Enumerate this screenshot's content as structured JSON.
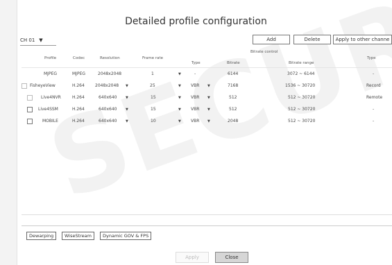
{
  "title": "Detailed profile configuration",
  "channel": {
    "value": "CH 01",
    "caret": "▼"
  },
  "buttons": {
    "add": "Add",
    "delete": "Delete",
    "apply_other": "Apply to other channe"
  },
  "headers": {
    "profile": "Profile",
    "codec": "Codec",
    "resolution": "Resolution",
    "frame_rate": "Frame rate",
    "bitrate_control": "Bitrate control",
    "type": "Type",
    "bitrate": "Bitrate",
    "bitrate_range": "Bitrate range",
    "type2": "Type"
  },
  "rows": [
    {
      "profile": "MJPEG",
      "codec": "MJPEG",
      "resolution": "2048x2048",
      "res_caret": "▼",
      "frame_rate": "1",
      "fr_caret": "▼",
      "type": "-",
      "type_caret": "",
      "bitrate": "6144",
      "range": "3072 ~ 6144",
      "use": "-",
      "has_check": false
    },
    {
      "profile": "FisheyeView",
      "codec": "H.264",
      "resolution": "2048x2048",
      "res_caret": "▼",
      "frame_rate": "25",
      "fr_caret": "▼",
      "type": "VBR",
      "type_caret": "▼",
      "bitrate": "7168",
      "range": "1536 ~ 30720",
      "use": "Record",
      "has_check": true
    },
    {
      "profile": "Live4NVR",
      "codec": "H.264",
      "resolution": "640x640",
      "res_caret": "▼",
      "frame_rate": "15",
      "fr_caret": "▼",
      "type": "VBR",
      "type_caret": "▼",
      "bitrate": "512",
      "range": "512 ~ 30720",
      "use": "Remote",
      "has_check": true
    },
    {
      "profile": "Live4SSM",
      "codec": "H.264",
      "resolution": "640x640",
      "res_caret": "▼",
      "frame_rate": "15",
      "fr_caret": "▼",
      "type": "VBR",
      "type_caret": "▼",
      "bitrate": "512",
      "range": "512 ~ 30720",
      "use": "-",
      "has_check": true
    },
    {
      "profile": "MOBILE",
      "codec": "H.264",
      "resolution": "640x640",
      "res_caret": "▼",
      "frame_rate": "10",
      "fr_caret": "▼",
      "type": "VBR",
      "type_caret": "▼",
      "bitrate": "2048",
      "range": "512 ~ 30720",
      "use": "-",
      "has_check": true
    }
  ],
  "tabs": {
    "dewarping": "Dewarping",
    "wisestream": "WiseStream",
    "dynamic_gov": "Dynamic GOV & FPS"
  },
  "footer": {
    "apply": "Apply",
    "close": "Close"
  },
  "watermark": "SECURE"
}
